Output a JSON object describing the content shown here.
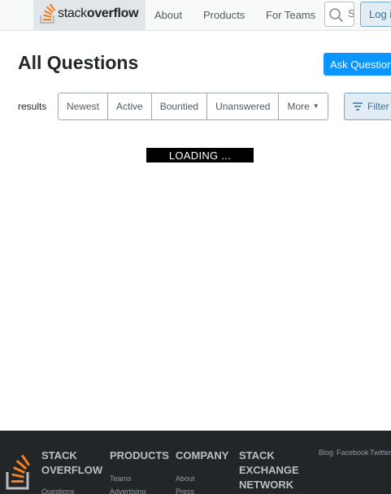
{
  "header": {
    "logo_text_light": "stack",
    "logo_text_bold": "overflow",
    "nav": [
      {
        "label": "About"
      },
      {
        "label": "Products"
      },
      {
        "label": "For Teams"
      }
    ],
    "search_placeholder": "Search",
    "login_label": "Log in"
  },
  "main": {
    "title": "All Questions",
    "ask_label": "Ask Question",
    "results_text": "results",
    "tabs": [
      {
        "label": "Newest"
      },
      {
        "label": "Active"
      },
      {
        "label": "Bountied"
      },
      {
        "label": "Unanswered"
      },
      {
        "label": "More"
      }
    ],
    "filter_label": "Filter",
    "loading_text": "LOADING ..."
  },
  "footer": {
    "so_title": "STACK OVERFLOW",
    "products_title": "PRODUCTS",
    "company_title": "COMPANY",
    "network_title": "STACK EXCHANGE NETWORK",
    "so_links": [
      "Questions"
    ],
    "products_links": [
      "Teams",
      "Advertising"
    ],
    "company_links": [
      "About",
      "Press"
    ],
    "social": [
      "Blog",
      "Facebook",
      "Twitter"
    ]
  },
  "colors": {
    "brand_orange": "#f48024",
    "accent_blue": "#0a95ff",
    "footer_bg": "#232629"
  },
  "icons": {
    "logo": "stack-overflow-logo-icon",
    "search": "search-icon",
    "filter": "filter-icon",
    "caret": "chevron-down-icon"
  }
}
